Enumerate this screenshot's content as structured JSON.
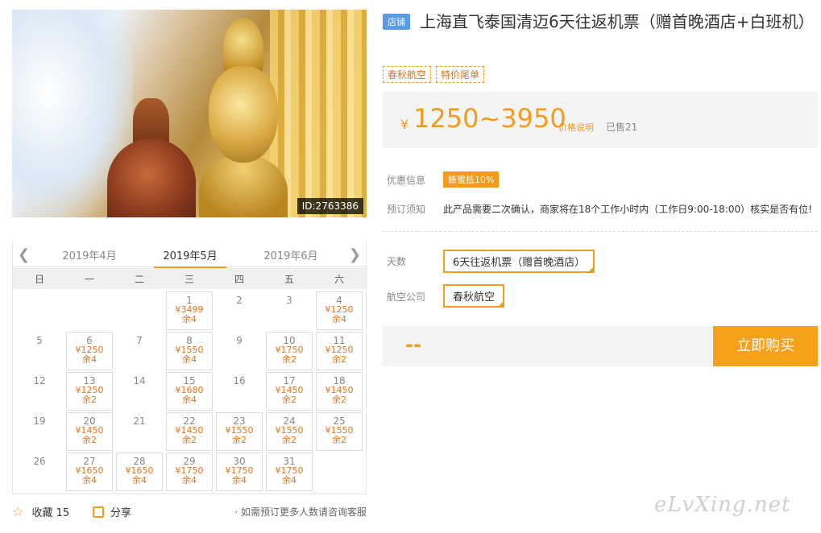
{
  "hero": {
    "image_id": "ID:2763386"
  },
  "calendar": {
    "prev_month": "2019年4月",
    "current_month": "2019年5月",
    "next_month": "2019年6月",
    "weekdays": [
      "日",
      "一",
      "二",
      "三",
      "四",
      "五",
      "六"
    ],
    "days": [
      {
        "day": "1",
        "price": "¥3499",
        "remain": "余4"
      },
      {
        "day": "2"
      },
      {
        "day": "3"
      },
      {
        "day": "4",
        "price": "¥1250",
        "remain": "余4"
      },
      {
        "day": "5"
      },
      {
        "day": "6",
        "price": "¥1250",
        "remain": "余4"
      },
      {
        "day": "7"
      },
      {
        "day": "8",
        "price": "¥1550",
        "remain": "余4"
      },
      {
        "day": "9"
      },
      {
        "day": "10",
        "price": "¥1750",
        "remain": "余2"
      },
      {
        "day": "11",
        "price": "¥1250",
        "remain": "余2"
      },
      {
        "day": "12"
      },
      {
        "day": "13",
        "price": "¥1250",
        "remain": "余2"
      },
      {
        "day": "14"
      },
      {
        "day": "15",
        "price": "¥1680",
        "remain": "余4"
      },
      {
        "day": "16"
      },
      {
        "day": "17",
        "price": "¥1450",
        "remain": "余2"
      },
      {
        "day": "18",
        "price": "¥1450",
        "remain": "余2"
      },
      {
        "day": "19"
      },
      {
        "day": "20",
        "price": "¥1450",
        "remain": "余2"
      },
      {
        "day": "21"
      },
      {
        "day": "22",
        "price": "¥1450",
        "remain": "余2"
      },
      {
        "day": "23",
        "price": "¥1550",
        "remain": "余2"
      },
      {
        "day": "24",
        "price": "¥1550",
        "remain": "余2"
      },
      {
        "day": "25",
        "price": "¥1550",
        "remain": "余2"
      },
      {
        "day": "26"
      },
      {
        "day": "27",
        "price": "¥1650",
        "remain": "余4"
      },
      {
        "day": "28",
        "price": "¥1650",
        "remain": "余4"
      },
      {
        "day": "29",
        "price": "¥1750",
        "remain": "余4"
      },
      {
        "day": "30",
        "price": "¥1750",
        "remain": "余4"
      },
      {
        "day": "31",
        "price": "¥1750",
        "remain": "余4"
      }
    ]
  },
  "footer": {
    "favorite_label": "收藏",
    "favorite_count": "15",
    "share_label": "分享",
    "tip": "· 如需预订更多人数请咨询客服"
  },
  "product": {
    "shop_tag": "店铺",
    "title": "上海直飞泰国清迈6天往返机票（赠首晚酒店+白班机）",
    "tags": [
      "春秋航空",
      "特价尾单"
    ],
    "currency": "¥",
    "price_range": "1250~3950",
    "price_note": "价格说明",
    "sold": "已售21",
    "promo_label": "优惠信息",
    "promo_badge": "蜂蜜抵10%",
    "notice_label": "预订须知",
    "notice_text": "此产品需要二次确认，商家将在18个工作小时内（工作日9:00-18:00）核实是否有位!",
    "days_label": "天数",
    "days_option": "6天往返机票（赠首晚酒店）",
    "airline_label": "航空公司",
    "airline_option": "春秋航空",
    "total": "--",
    "buy_label": "立即购买"
  },
  "watermark": "eLvXing.net",
  "colors": {
    "accent": "#f39b1c",
    "price": "#f39b1c",
    "shop_tag": "#5b9be6"
  }
}
